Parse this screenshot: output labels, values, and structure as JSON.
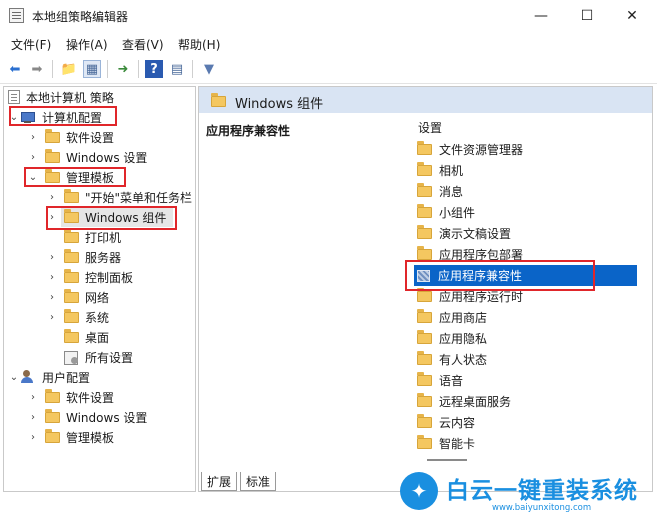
{
  "window": {
    "title": "本地组策略编辑器"
  },
  "menu": [
    "文件(F)",
    "操作(A)",
    "查看(V)",
    "帮助(H)"
  ],
  "tree": {
    "root": "本地计算机 策略",
    "computer_config": "计算机配置",
    "software_settings": "软件设置",
    "windows_settings": "Windows 设置",
    "admin_templates": "管理模板",
    "start_menu": "\"开始\"菜单和任务栏",
    "windows_components": "Windows 组件",
    "printers": "打印机",
    "server": "服务器",
    "control_panel": "控制面板",
    "network": "网络",
    "system": "系统",
    "desktop": "桌面",
    "all_settings": "所有设置",
    "user_config": "用户配置",
    "user_software_settings": "软件设置",
    "user_windows_settings": "Windows 设置",
    "user_admin_templates": "管理模板"
  },
  "content": {
    "header_title": "Windows 组件",
    "selected_title": "应用程序兼容性",
    "column_header": "设置",
    "items": [
      "文件资源管理器",
      "相机",
      "消息",
      "小组件",
      "演示文稿设置",
      "应用程序包部署",
      "应用程序兼容性",
      "应用程序运行时",
      "应用商店",
      "应用隐私",
      "有人状态",
      "语音",
      "远程桌面服务",
      "云内容",
      "智能卡"
    ],
    "selected_index": 6
  },
  "tabs": [
    "扩展",
    "标准"
  ],
  "watermark": {
    "title": "白云一键重装系统",
    "url": "www.baiyunxitong.com"
  },
  "colors": {
    "selection": "#0a64c8",
    "highlight_box": "#e0262a",
    "header_bg": "#d9e4f3"
  }
}
